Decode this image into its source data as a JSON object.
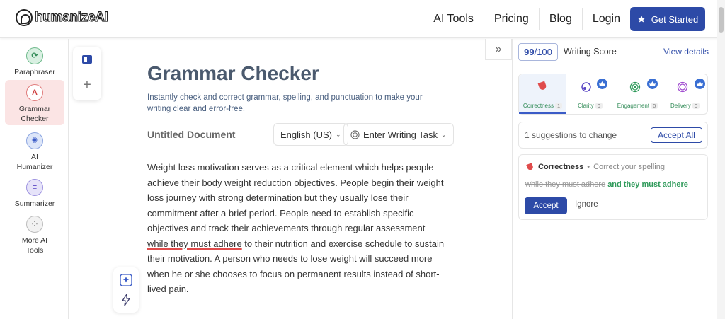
{
  "header": {
    "logo_text": "humanizeAI",
    "nav": [
      "AI Tools",
      "Pricing",
      "Blog",
      "Login"
    ],
    "cta_label": "Get Started"
  },
  "sidebar": {
    "items": [
      {
        "label": "Paraphraser",
        "icon": "paraphraser-icon"
      },
      {
        "label": "Grammar Checker",
        "icon": "grammar-icon"
      },
      {
        "label": "AI Humanizer",
        "icon": "brain-icon"
      },
      {
        "label": "Summarizer",
        "icon": "summarizer-icon"
      },
      {
        "label": "More AI Tools",
        "icon": "grid-icon"
      }
    ]
  },
  "editor": {
    "title": "Grammar Checker",
    "subtitle": "Instantly check and correct grammar, spelling, and punctuation to make your writing clear and error-free.",
    "doc_name": "Untitled Document",
    "language": "English (US)",
    "task_label": "Enter Writing Task",
    "text_before": "Weight loss motivation serves as a critical element which helps people achieve their body weight reduction objectives. People begin their weight loss journey with strong determination but they usually lose their commitment after a brief period. People need to establish specific objectives and track their achievements through regular assessment ",
    "text_error": "while they must adhere",
    "text_after": " to their nutrition and exercise schedule to sustain their motivation. A person who needs to lose weight will succeed more when he or she chooses to focus on permanent results instead of short-lived pain."
  },
  "panel": {
    "score_value": "99",
    "score_total": "/100",
    "score_label": "Writing Score",
    "view_details": "View details",
    "categories": [
      {
        "label": "Correctness",
        "count": "1"
      },
      {
        "label": "Clarity",
        "count": "0"
      },
      {
        "label": "Engagement",
        "count": "0"
      },
      {
        "label": "Delivery",
        "count": "0"
      }
    ],
    "suggestions_text": "1 suggestions to change",
    "accept_all": "Accept All",
    "card": {
      "category": "Correctness",
      "separator": "•",
      "hint": "Correct your spelling",
      "original": "while they must adhere",
      "replacement": "and they must adhere",
      "accept": "Accept",
      "ignore": "Ignore"
    }
  },
  "colors": {
    "brand": "#2d4aa7",
    "correctness": "#e04b4b",
    "success": "#2f9a5a"
  }
}
